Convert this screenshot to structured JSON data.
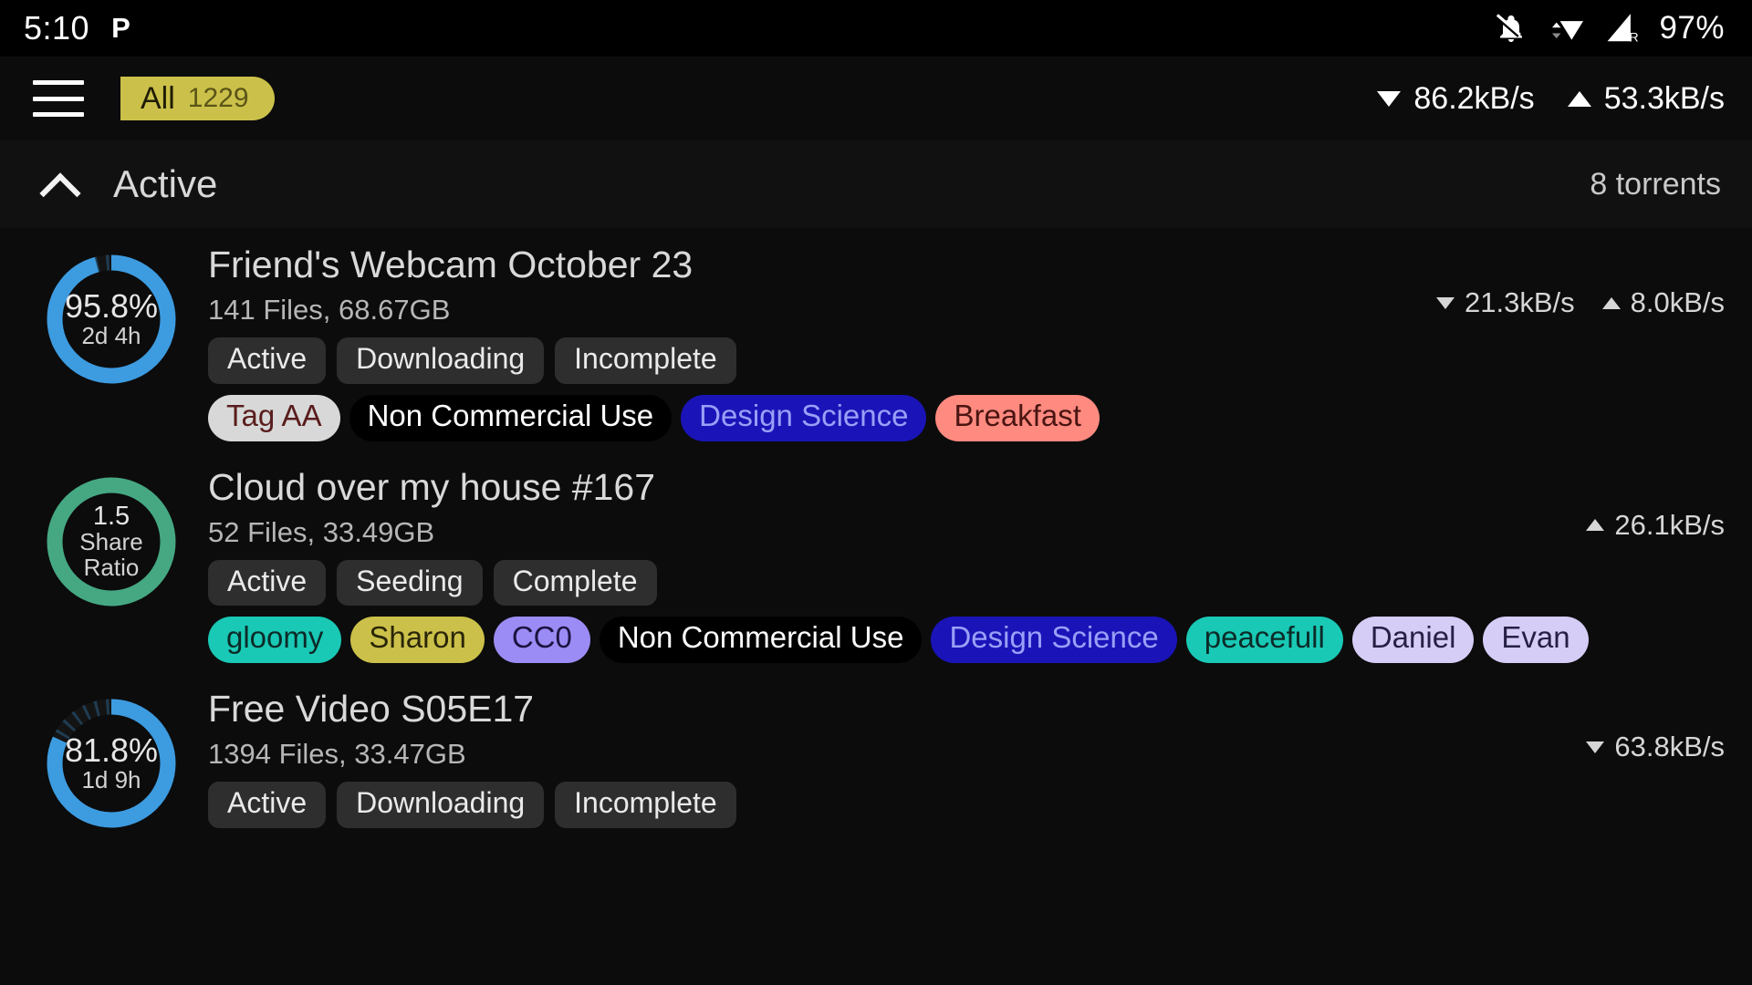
{
  "statusbar": {
    "time": "5:10",
    "app_icon": "pushbullet-icon",
    "icons": [
      "bell-off-icon",
      "wifi-icon",
      "cellular-roaming-icon"
    ],
    "battery": "97%"
  },
  "toolbar": {
    "menu_icon": "hamburger-menu-icon",
    "filter": {
      "label": "All",
      "count": "1229"
    },
    "download_speed": "86.2kB/s",
    "upload_speed": "53.3kB/s"
  },
  "section": {
    "collapse_icon": "chevron-up-icon",
    "title": "Active",
    "count": "8 torrents"
  },
  "torrents": [
    {
      "name": "Friend's Webcam October 23",
      "meta": "141 Files, 68.67GB",
      "ring": {
        "main": "95.8%",
        "sub": "2d 4h",
        "percent": 95.8,
        "color": "#3d9be0",
        "track": "#141414"
      },
      "download_speed": "21.3kB/s",
      "upload_speed": "8.0kB/s",
      "status": [
        "Active",
        "Downloading",
        "Incomplete"
      ],
      "tags": [
        {
          "label": "Tag AA",
          "bg": "#d8d8d8",
          "fg": "#5a1d1d"
        },
        {
          "label": "Non Commercial Use",
          "bg": "#000000",
          "fg": "#ffffff"
        },
        {
          "label": "Design Science",
          "bg": "#1a14b8",
          "fg": "#9aa0f7"
        },
        {
          "label": "Breakfast",
          "bg": "#ff8a80",
          "fg": "#4a1512"
        }
      ]
    },
    {
      "name": "Cloud over my house #167",
      "meta": "52 Files, 33.49GB",
      "ring": {
        "main": "1.5",
        "sub": "Share\nRatio",
        "sub_line1": "Share",
        "sub_line2": "Ratio",
        "percent": 100,
        "color": "#45a883",
        "track": "#141414"
      },
      "download_speed": "",
      "upload_speed": "26.1kB/s",
      "status": [
        "Active",
        "Seeding",
        "Complete"
      ],
      "tags": [
        {
          "label": "gloomy",
          "bg": "#19c9b5",
          "fg": "#0c2b28"
        },
        {
          "label": "Sharon",
          "bg": "#cbc14a",
          "fg": "#2a2608"
        },
        {
          "label": "CC0",
          "bg": "#9b8cf5",
          "fg": "#1c1340"
        },
        {
          "label": "Non Commercial Use",
          "bg": "#000000",
          "fg": "#ffffff"
        },
        {
          "label": "Design Science",
          "bg": "#1a14b8",
          "fg": "#9aa0f7"
        },
        {
          "label": "peacefull",
          "bg": "#19c9b5",
          "fg": "#0c2b28"
        },
        {
          "label": "Daniel",
          "bg": "#d6cdf7",
          "fg": "#262045"
        },
        {
          "label": "Evan",
          "bg": "#d6cdf7",
          "fg": "#262045"
        }
      ]
    },
    {
      "name": "Free Video S05E17",
      "meta": "1394 Files, 33.47GB",
      "ring": {
        "main": "81.8%",
        "sub": "1d 9h",
        "percent": 81.8,
        "color": "#3d9be0",
        "track": "#141414"
      },
      "download_speed": "63.8kB/s",
      "upload_speed": "",
      "status": [
        "Active",
        "Downloading",
        "Incomplete"
      ],
      "tags": []
    }
  ]
}
